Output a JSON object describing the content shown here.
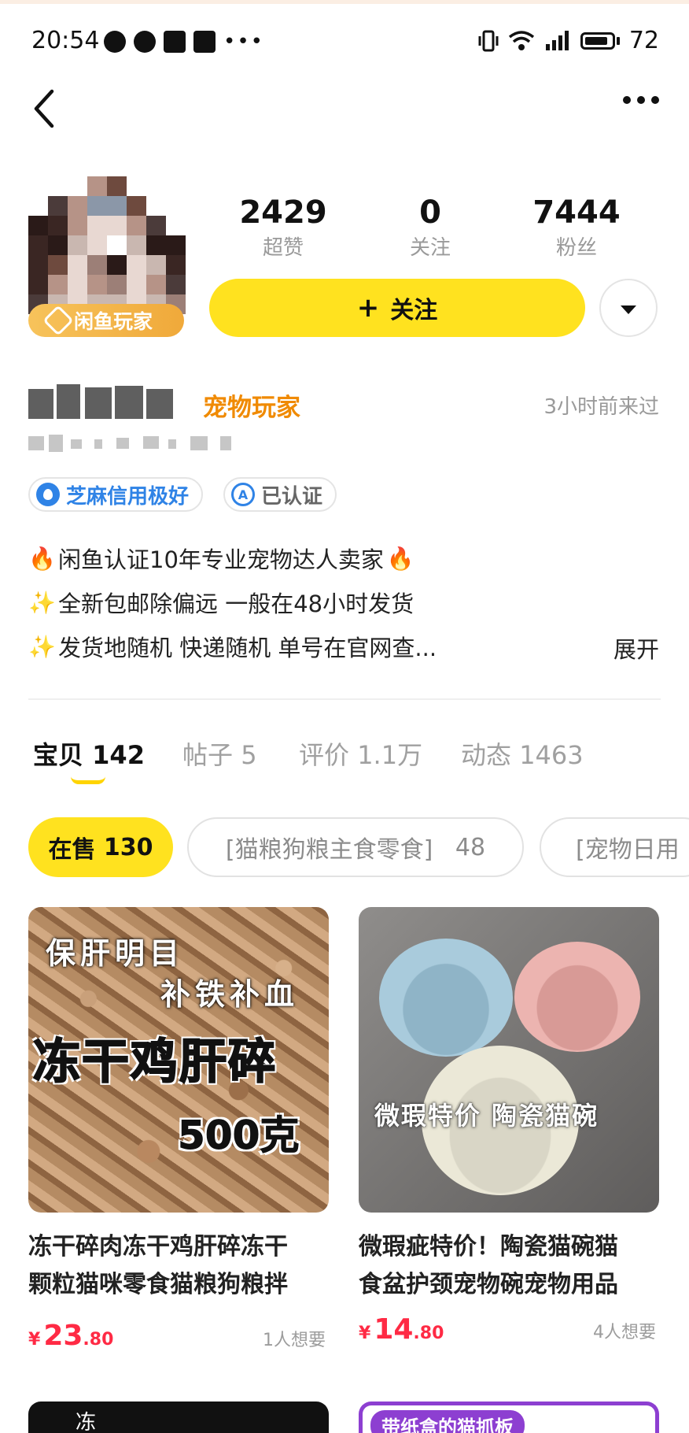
{
  "status_bar": {
    "time": "20:54",
    "battery": "72"
  },
  "profile": {
    "player_badge": "闲鱼玩家",
    "stats": [
      {
        "value": "2429",
        "label": "超赞"
      },
      {
        "value": "0",
        "label": "关注"
      },
      {
        "value": "7444",
        "label": "粉丝"
      }
    ],
    "follow_label": "关注",
    "user_tag": "宠物玩家",
    "last_seen": "3小时前来过",
    "tags": [
      "芝麻信用极好",
      "已认证"
    ],
    "bio": [
      {
        "prefix": "🔥",
        "text": "闲鱼认证10年专业宠物达人卖家",
        "suffix": "🔥"
      },
      {
        "prefix": "✨",
        "text": "全新包邮除偏远 一般在48小时发货",
        "suffix": ""
      },
      {
        "prefix": "✨",
        "text": "发货地随机 快递随机 单号在官网查...",
        "suffix": ""
      }
    ],
    "expand_label": "展开"
  },
  "tabs": [
    {
      "name": "宝贝",
      "count": "142"
    },
    {
      "name": "帖子",
      "count": "5"
    },
    {
      "name": "评价",
      "count": "1.1万"
    },
    {
      "name": "动态",
      "count": "1463"
    }
  ],
  "filters": [
    {
      "label": "在售",
      "count": "130"
    },
    {
      "label": "[猫粮狗粮主食零食]",
      "count": "48"
    },
    {
      "label": "[宠物日用"
    }
  ],
  "products": [
    {
      "img_lines": [
        "保肝明目",
        "补铁补血",
        "冻干鸡肝碎",
        "500克"
      ],
      "title_lines": [
        "冻干碎肉冻干鸡肝碎冻干",
        "颗粒猫咪零食猫粮狗粮拌"
      ],
      "price_currency": "¥",
      "price_int": "23",
      "price_dec": ".80",
      "wants": "1人想要"
    },
    {
      "img_lines": [
        "微瑕特价 陶瓷猫碗"
      ],
      "title_lines": [
        "微瑕疵特价！陶瓷猫碗猫",
        "食盆护颈宠物碗宠物用品"
      ],
      "price_currency": "¥",
      "price_int": "14",
      "price_dec": ".80",
      "wants": "4人想要"
    }
  ],
  "peek": {
    "card1_text": "冻",
    "card2_text": "带纸盒的猫抓板"
  },
  "colors": {
    "accent_yellow": "#ffe21f",
    "price_red": "#ff2a44",
    "tag_orange": "#f08a00",
    "credit_blue": "#2f83e6"
  }
}
